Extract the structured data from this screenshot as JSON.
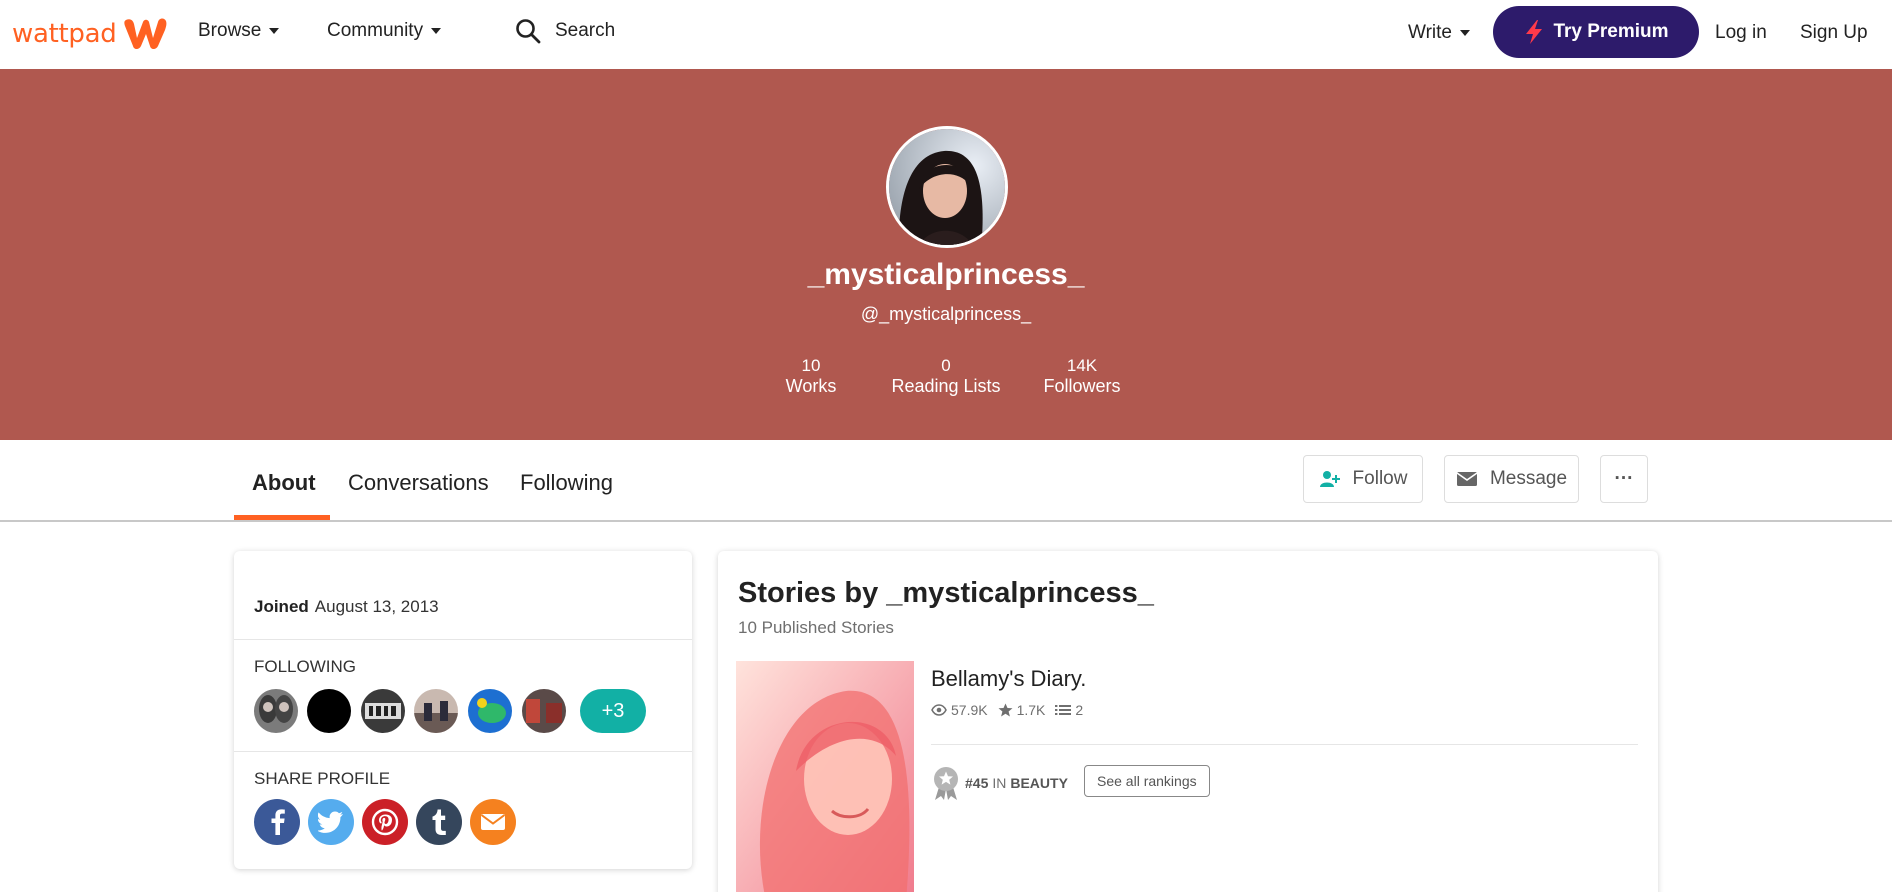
{
  "nav": {
    "logo_text": "wattpad",
    "browse": "Browse",
    "community": "Community",
    "search": "Search",
    "write": "Write",
    "premium": "Try Premium",
    "login": "Log in",
    "signup": "Sign Up"
  },
  "profile": {
    "display_name": "_mysticalprincess_",
    "handle": "@_mysticalprincess_",
    "stats": [
      {
        "value": "10",
        "label": "Works"
      },
      {
        "value": "0",
        "label": "Reading Lists"
      },
      {
        "value": "14K",
        "label": "Followers"
      }
    ]
  },
  "tabs": [
    "About",
    "Conversations",
    "Following"
  ],
  "actions": {
    "follow": "Follow",
    "message": "Message",
    "more": "···"
  },
  "about": {
    "joined_label": "Joined",
    "joined_date": "August 13, 2013",
    "following_label": "FOLLOWING",
    "following_more": "+3",
    "share_label": "SHARE PROFILE",
    "share_icons": [
      "facebook-icon",
      "twitter-icon",
      "pinterest-icon",
      "tumblr-icon",
      "email-icon"
    ]
  },
  "stories": {
    "title": "Stories by _mysticalprincess_",
    "subtitle": "10 Published Stories",
    "items": [
      {
        "title": "Bellamy's Diary.",
        "reads": "57.9K",
        "votes": "1.7K",
        "parts": "2",
        "rank_num": "#45",
        "rank_in": "IN",
        "rank_tag": "BEAUTY",
        "see_rankings": "See all rankings"
      }
    ]
  },
  "colors": {
    "brand": "#ff6122",
    "header_band": "#b0584f",
    "premium": "#2d1b6b",
    "teal": "#12b0a5"
  }
}
